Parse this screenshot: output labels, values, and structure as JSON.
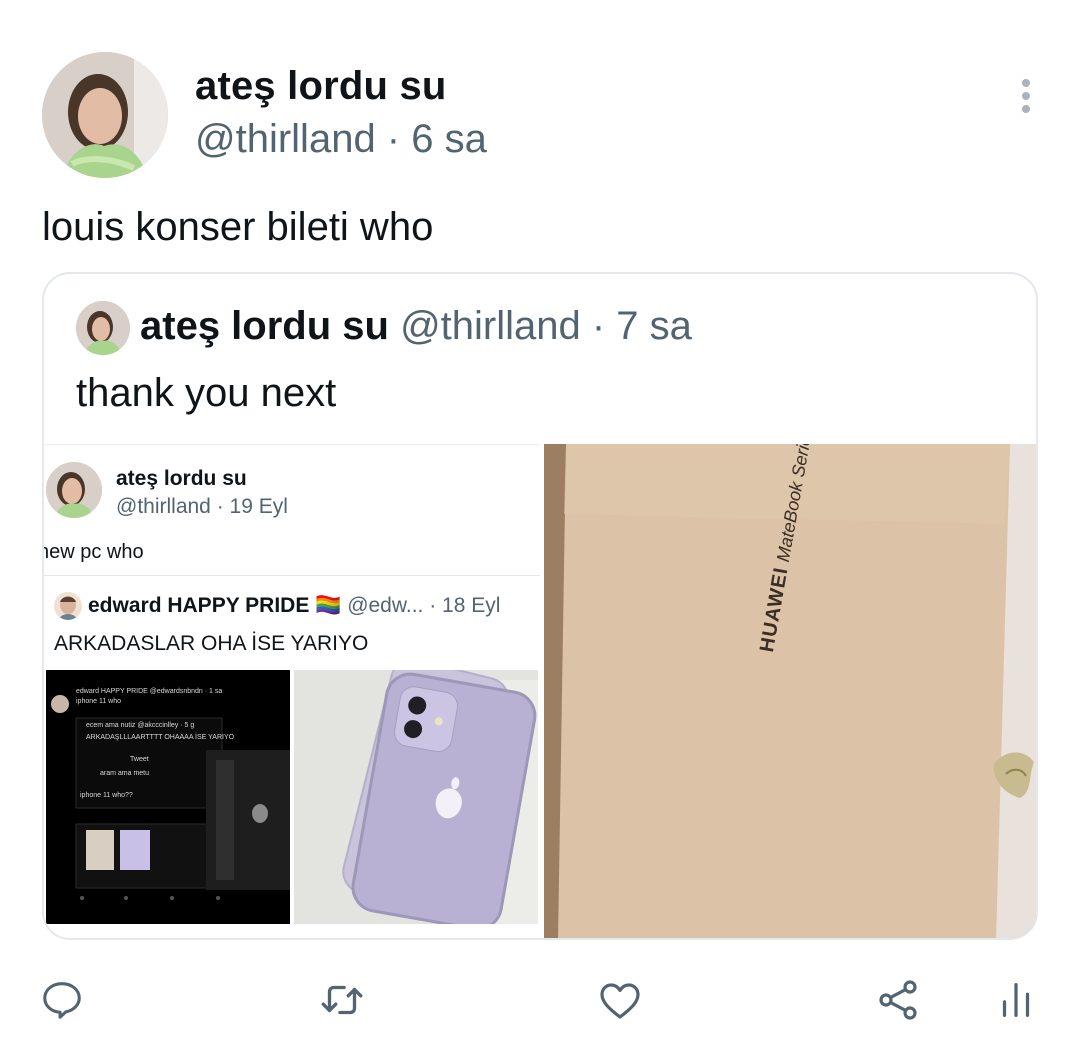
{
  "tweet": {
    "display_name": "ateş lordu su",
    "handle_time": "@thirlland · 6 sa",
    "text": "louis konser bileti who"
  },
  "quote": {
    "display_name": "ateş lordu su",
    "meta": "@thirlland · 7 sa",
    "text": "thank you next",
    "screenshot": {
      "display_name": "ateş lordu su",
      "handle_time": "@thirlland · 19 Eyl",
      "text": "new pc who",
      "inner_quote": {
        "display_name": "edward HAPPY PRIDE",
        "flag": "🏳️‍🌈",
        "meta": "@edw... · 18 Eyl",
        "text": "ARKADASLAR OHA İSE YARIYO",
        "dark_shot": {
          "name_line": "edward HAPPY PRIDE @edwardsnbndn · 1 sa",
          "text1": "iphone 11 who",
          "quote_name": "ecem ama nutiz @akcccinlley · 5 g",
          "quote_text": "ARKADAŞLLLAARTTTT OHAAAA İSE YARIYO",
          "tab": "Tweet",
          "line1": "aram ama metu",
          "line2": "iphone 11 who??"
        }
      },
      "box_brand": "HUAWEI",
      "box_series": "MateBook Series"
    }
  },
  "actions": {
    "reply": "reply-icon",
    "retweet": "retweet-icon",
    "like": "heart-icon",
    "share": "share-icon",
    "analytics": "analytics-icon"
  }
}
